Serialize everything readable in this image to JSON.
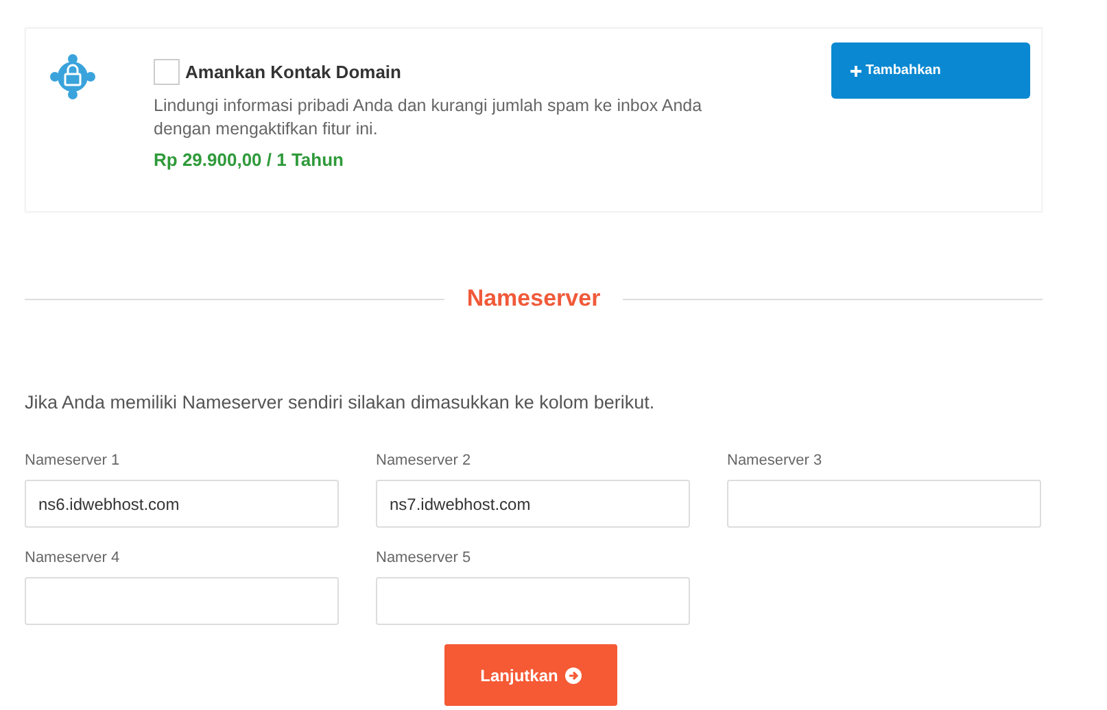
{
  "addon": {
    "title": "Amankan Kontak Domain",
    "checked": false,
    "description": "Lindungi informasi pribadi Anda dan kurangi jumlah spam ke inbox Anda dengan mengaktifkan fitur ini.",
    "price": "Rp 29.900,00 / 1 Tahun",
    "button": "Tambahkan"
  },
  "nameserver_section": {
    "heading": "Nameserver",
    "intro": "Jika Anda memiliki Nameserver sendiri silakan dimasukkan ke kolom berikut.",
    "fields": [
      {
        "label": "Nameserver 1",
        "value": "ns6.idwebhost.com"
      },
      {
        "label": "Nameserver 2",
        "value": "ns7.idwebhost.com"
      },
      {
        "label": "Nameserver 3"
      },
      {
        "label": "Nameserver 4"
      },
      {
        "label": "Nameserver 5"
      }
    ],
    "submit": "Lanjutkan"
  }
}
